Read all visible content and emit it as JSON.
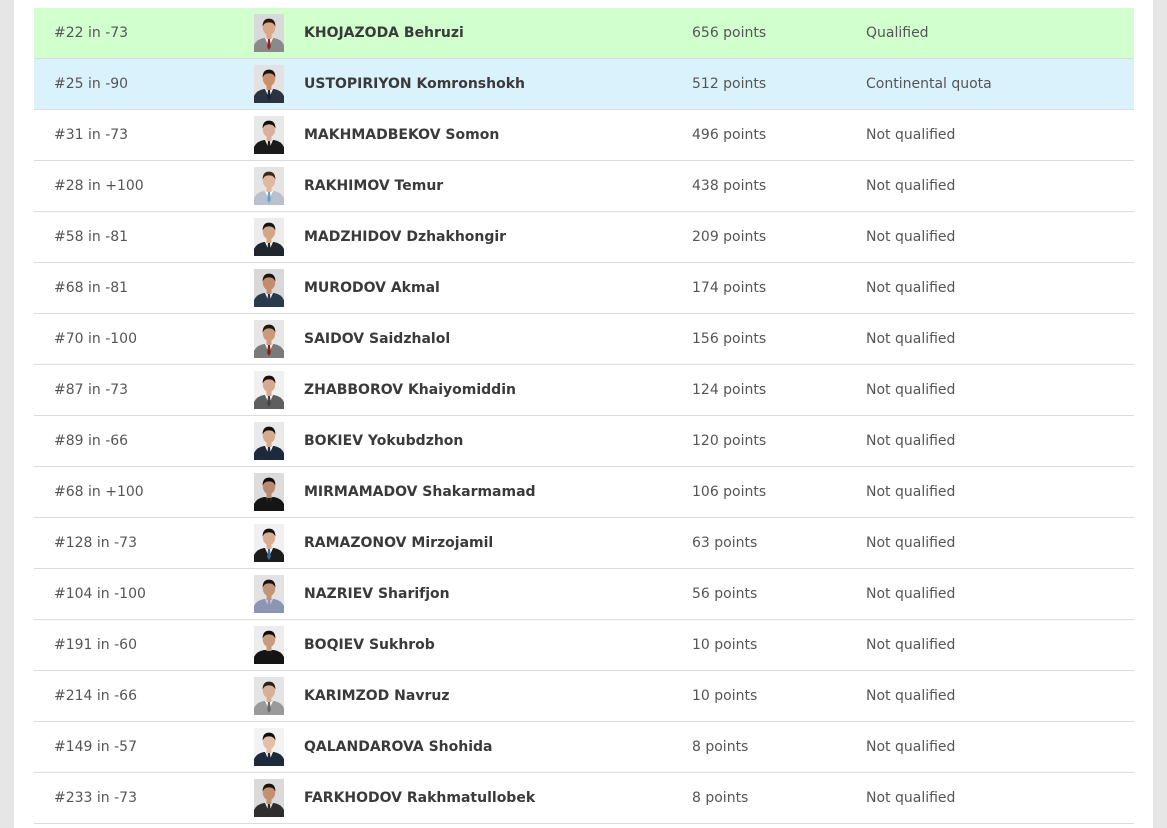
{
  "athletes": [
    {
      "rank": "#22 in -73",
      "name": "KHOJAZODA Behruzi",
      "points": "656 points",
      "status": "Qualified",
      "highlight": "qualified",
      "bg": "#d9d9d9",
      "suit": "#8a8a8a",
      "shirt": "#ffffff",
      "tie": "#9a2020",
      "hair": "#2a1a10",
      "skin": "#d8a888"
    },
    {
      "rank": "#25 in -90",
      "name": "USTOPIRIYON Komronshokh",
      "points": "512 points",
      "status": "Continental quota",
      "highlight": "continental",
      "bg": "#e2e2e2",
      "suit": "#2a3340",
      "shirt": "#ffffff",
      "tie": "#1b2433",
      "hair": "#1a1410",
      "skin": "#c9906c"
    },
    {
      "rank": "#31 in -73",
      "name": "MAKHMADBEKOV Somon",
      "points": "496 points",
      "status": "Not qualified",
      "highlight": "",
      "bg": "#e8e8e8",
      "suit": "#1a1a1a",
      "shirt": "#f2f2f2",
      "tie": "#1a1a1a",
      "hair": "#0d0d0d",
      "skin": "#d9b099"
    },
    {
      "rank": "#28 in +100",
      "name": "RAKHIMOV Temur",
      "points": "438 points",
      "status": "Not qualified",
      "highlight": "",
      "bg": "#e4e4e4",
      "suit": "#b9c2cc",
      "shirt": "#ffffff",
      "tie": "#6aa0c8",
      "hair": "#3a2a1e",
      "skin": "#e0b89c"
    },
    {
      "rank": "#58 in -81",
      "name": "MADZHIDOV Dzhakhongir",
      "points": "209 points",
      "status": "Not qualified",
      "highlight": "",
      "bg": "#ececec",
      "suit": "#20262e",
      "shirt": "#ffffff",
      "tie": "#20262e",
      "hair": "#141414",
      "skin": "#d2a688"
    },
    {
      "rank": "#68 in -81",
      "name": "MURODOV Akmal",
      "points": "174 points",
      "status": "Not qualified",
      "highlight": "",
      "bg": "#d8d8d8",
      "suit": "#2b3a4a",
      "shirt": "#f5f5f5",
      "tie": "#2b3a4a",
      "hair": "#1b1410",
      "skin": "#c48c6c"
    },
    {
      "rank": "#70 in -100",
      "name": "SAIDOV Saidzhalol",
      "points": "156 points",
      "status": "Not qualified",
      "highlight": "",
      "bg": "#e6e6e6",
      "suit": "#7a7a7a",
      "shirt": "#ffffff",
      "tie": "#8c1c1c",
      "hair": "#1e1812",
      "skin": "#cc9a7a"
    },
    {
      "rank": "#87 in -73",
      "name": "ZHABBOROV Khaiyomiddin",
      "points": "124 points",
      "status": "Not qualified",
      "highlight": "",
      "bg": "#f0f0f0",
      "suit": "#5e5e5e",
      "shirt": "#ffffff",
      "tie": "#444444",
      "hair": "#18120e",
      "skin": "#d4aa90"
    },
    {
      "rank": "#89 in -66",
      "name": "BOKIEV Yokubdzhon",
      "points": "120 points",
      "status": "Not qualified",
      "highlight": "",
      "bg": "#e9e9e9",
      "suit": "#1d2a3c",
      "shirt": "#ffffff",
      "tie": "#1d2a3c",
      "hair": "#111111",
      "skin": "#d6aa8c"
    },
    {
      "rank": "#68 in +100",
      "name": "MIRMAMADOV Shakarmamad",
      "points": "106 points",
      "status": "Not qualified",
      "highlight": "",
      "bg": "#dcdcdc",
      "suit": "#151515",
      "shirt": "#2a2a2a",
      "tie": "#151515",
      "hair": "#0d0d0d",
      "skin": "#b88a72"
    },
    {
      "rank": "#128 in -73",
      "name": "RAMAZONOV Mirzojamil",
      "points": "63 points",
      "status": "Not qualified",
      "highlight": "",
      "bg": "#f0f0f0",
      "suit": "#1c1c1c",
      "shirt": "#ffffff",
      "tie": "#3a6a9a",
      "hair": "#121212",
      "skin": "#d8ae92"
    },
    {
      "rank": "#104 in -100",
      "name": "NAZRIEV Sharifjon",
      "points": "56 points",
      "status": "Not qualified",
      "highlight": "",
      "bg": "#e2e2e2",
      "suit": "#8c96b2",
      "shirt": "#c8cde0",
      "tie": "#8c96b2",
      "hair": "#141414",
      "skin": "#c29478"
    },
    {
      "rank": "#191 in -60",
      "name": "BOQIEV Sukhrob",
      "points": "10 points",
      "status": "Not qualified",
      "highlight": "",
      "bg": "#ececec",
      "suit": "#141414",
      "shirt": "#1c1c1c",
      "tie": "#141414",
      "hair": "#0c0c0c",
      "skin": "#c89a7e"
    },
    {
      "rank": "#214 in -66",
      "name": "KARIMZOD Navruz",
      "points": "10 points",
      "status": "Not qualified",
      "highlight": "",
      "bg": "#e4e4e4",
      "suit": "#9a9a9a",
      "shirt": "#ffffff",
      "tie": "#6a6a6a",
      "hair": "#2a2018",
      "skin": "#d8b098"
    },
    {
      "rank": "#149 in -57",
      "name": "QALANDAROVA Shohida",
      "points": "8 points",
      "status": "Not qualified",
      "highlight": "",
      "bg": "#f2f2f2",
      "suit": "#1e2a3a",
      "shirt": "#ffffff",
      "tie": "#1e2a3a",
      "hair": "#0e0e0e",
      "skin": "#e2c0a8"
    },
    {
      "rank": "#233 in -73",
      "name": "FARKHODOV Rakhmatullobek",
      "points": "8 points",
      "status": "Not qualified",
      "highlight": "",
      "bg": "#dadada",
      "suit": "#2e2e2e",
      "shirt": "#e8e8e8",
      "tie": "#2e2e2e",
      "hair": "#1a140e",
      "skin": "#c49070"
    }
  ]
}
